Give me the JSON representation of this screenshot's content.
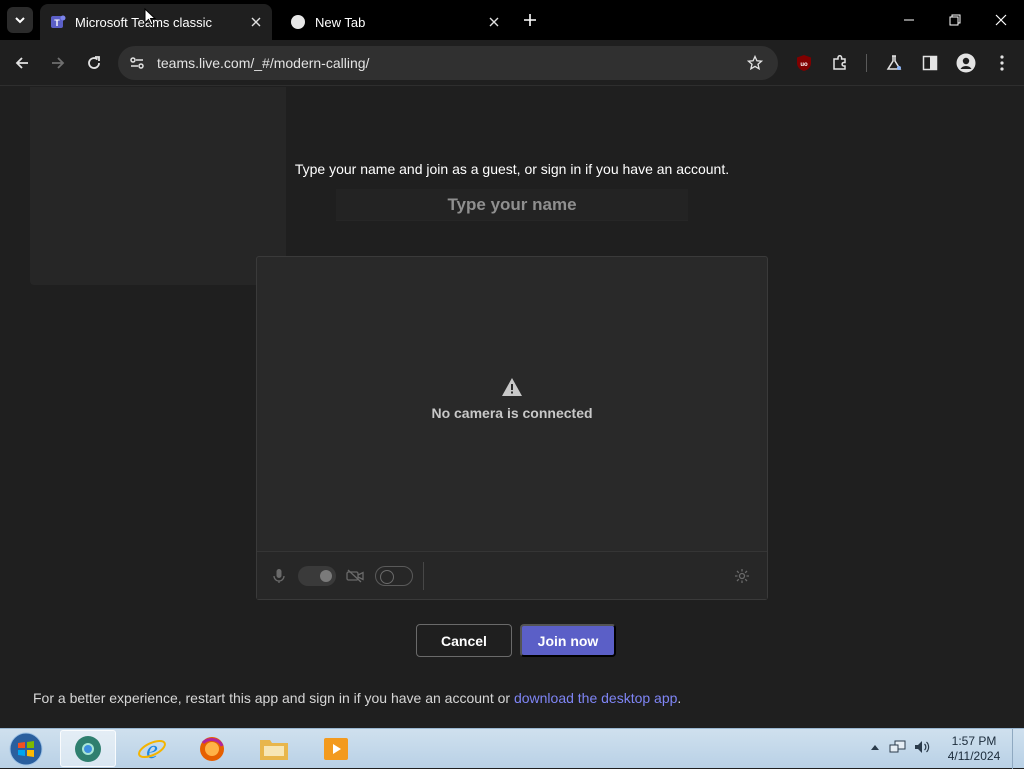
{
  "browser": {
    "tabs": [
      {
        "title": "Microsoft Teams classic",
        "active": true
      },
      {
        "title": "New Tab",
        "active": false
      }
    ],
    "url": "teams.live.com/_#/modern-calling/"
  },
  "page": {
    "intro_text": "Type your name and join as a guest, or sign in if you have an account.",
    "name_placeholder": "Type your name",
    "camera_status": "No camera is connected",
    "cancel_label": "Cancel",
    "join_label": "Join now",
    "footer_text": "For a better experience, restart this app and sign in if you have an account or ",
    "footer_link": "download the desktop app",
    "footer_end": ".",
    "mic_toggle_on": true,
    "camera_toggle_on": false
  },
  "taskbar": {
    "time": "1:57 PM",
    "date": "4/11/2024"
  },
  "colors": {
    "accent": "#5b5fc7",
    "link": "#7f85f5",
    "background": "#1f1f1f"
  }
}
